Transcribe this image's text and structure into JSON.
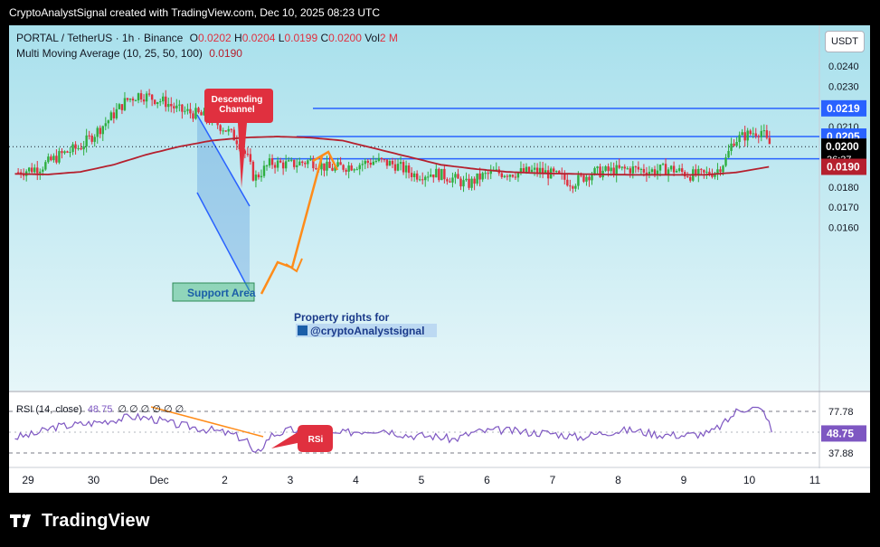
{
  "header": {
    "caption": "CryptoAnalystSignal created with TradingView.com, Dec 10, 2025 08:23 UTC"
  },
  "legend": {
    "symbol": "PORTAL / TetherUS · 1h · Binance",
    "o_label": "O",
    "o_value": "0.0202",
    "h_label": "H",
    "h_value": "0.0204",
    "l_label": "L",
    "l_value": "0.0199",
    "c_label": "C",
    "c_value": "0.0200",
    "vol_label": "Vol",
    "vol_value": "2 M",
    "ma_label": "Multi Moving Average (10, 25, 50, 100)",
    "ma_value": "0.0190"
  },
  "currency_badge": "USDT",
  "annotations": {
    "descending_channel": [
      "Descending",
      "Channel"
    ],
    "support_area": "Support Area",
    "watermark_line1": "Property rights for",
    "watermark_line2": "@cryptoAnalystsignal",
    "rsi_callout": "RSi"
  },
  "rsi_legend": {
    "label": "RSI (14, close)",
    "value": "48.75",
    "extra": "∅ ∅ ∅ ∅ ∅ ∅"
  },
  "brand": {
    "name": "TradingView"
  },
  "colors": {
    "background_top": "#a8e0ec",
    "background_bottom": "#e6f6f9",
    "candle_up": "#2eae3f",
    "candle_down": "#e0303f",
    "ma_line": "#b5202e",
    "level_line": "#2962ff",
    "arrow": "#ff8c1a",
    "rsi_line": "#7e57c2",
    "channel_fill": "#4a90d9"
  },
  "chart_data": [
    {
      "type": "candlestick",
      "title": "PORTAL / TetherUS · 1h · Binance",
      "x_tick_labels": [
        "29",
        "30",
        "Dec",
        "2",
        "3",
        "4",
        "5",
        "6",
        "7",
        "8",
        "9",
        "10",
        "11"
      ],
      "y_tick_labels": [
        "0.0240",
        "0.0230",
        "0.0220",
        "0.0210",
        "0.0200",
        "0.0190",
        "0.0180",
        "0.0170",
        "0.0160"
      ],
      "ylim": [
        0.016,
        0.0246
      ],
      "price_path_points": [
        [
          28.8,
          0.0187
        ],
        [
          29.2,
          0.019
        ],
        [
          29.5,
          0.0196
        ],
        [
          29.8,
          0.02
        ],
        [
          30.0,
          0.0206
        ],
        [
          30.25,
          0.0214
        ],
        [
          30.5,
          0.0223
        ],
        [
          30.7,
          0.0226
        ],
        [
          30.9,
          0.0224
        ],
        [
          31.1,
          0.0222
        ],
        [
          31.3,
          0.0218
        ],
        [
          31.6,
          0.0216
        ],
        [
          31.8,
          0.0213
        ],
        [
          32.0,
          0.0209
        ],
        [
          32.2,
          0.0203
        ],
        [
          32.35,
          0.0194
        ],
        [
          32.45,
          0.0184
        ],
        [
          32.7,
          0.0192
        ],
        [
          33.0,
          0.0191
        ],
        [
          33.3,
          0.0193
        ],
        [
          33.6,
          0.0189
        ],
        [
          34.0,
          0.0191
        ],
        [
          34.3,
          0.0193
        ],
        [
          34.6,
          0.0191
        ],
        [
          34.9,
          0.0186
        ],
        [
          35.2,
          0.0187
        ],
        [
          35.5,
          0.0184
        ],
        [
          35.7,
          0.0181
        ],
        [
          35.9,
          0.0185
        ],
        [
          36.1,
          0.0187
        ],
        [
          36.4,
          0.0187
        ],
        [
          36.8,
          0.0188
        ],
        [
          37.1,
          0.0185
        ],
        [
          37.3,
          0.0182
        ],
        [
          37.6,
          0.0187
        ],
        [
          37.9,
          0.0188
        ],
        [
          38.2,
          0.0189
        ],
        [
          38.5,
          0.0188
        ],
        [
          38.8,
          0.0189
        ],
        [
          39.1,
          0.0186
        ],
        [
          39.3,
          0.0186
        ],
        [
          39.5,
          0.0188
        ],
        [
          39.65,
          0.0194
        ],
        [
          39.75,
          0.0203
        ],
        [
          39.9,
          0.0205
        ],
        [
          40.05,
          0.0207
        ],
        [
          40.2,
          0.0208
        ],
        [
          40.25,
          0.0203
        ],
        [
          40.35,
          0.02
        ]
      ],
      "levels": [
        {
          "label": "0.0219",
          "value": 0.0219
        },
        {
          "label": "0.0205",
          "value": 0.0205
        },
        {
          "label": "0.0194",
          "value": 0.0194
        }
      ],
      "current_price": {
        "label": "0.0200",
        "countdown": "36:37",
        "value": 0.02
      },
      "ma": {
        "label": "0.0190",
        "value": 0.019,
        "points": [
          [
            28.8,
            0.01865
          ],
          [
            29.3,
            0.01862
          ],
          [
            29.8,
            0.01875
          ],
          [
            30.3,
            0.0191
          ],
          [
            30.8,
            0.0196
          ],
          [
            31.3,
            0.02
          ],
          [
            31.8,
            0.0203
          ],
          [
            32.3,
            0.02045
          ],
          [
            32.8,
            0.0205
          ],
          [
            33.3,
            0.02045
          ],
          [
            33.8,
            0.0203
          ],
          [
            34.3,
            0.0199
          ],
          [
            34.8,
            0.0195
          ],
          [
            35.3,
            0.0191
          ],
          [
            35.8,
            0.0189
          ],
          [
            36.3,
            0.01875
          ],
          [
            36.8,
            0.01868
          ],
          [
            37.3,
            0.01865
          ],
          [
            37.8,
            0.01862
          ],
          [
            38.3,
            0.0186
          ],
          [
            38.8,
            0.0186
          ],
          [
            39.3,
            0.0186
          ],
          [
            39.8,
            0.01872
          ],
          [
            40.3,
            0.019
          ]
        ]
      }
    },
    {
      "type": "line",
      "title": "RSI (14, close)",
      "y_tick_labels": [
        "77.78",
        "37.88"
      ],
      "band": [
        30,
        70
      ],
      "current": {
        "label": "48.75",
        "value": 48.75
      },
      "points": [
        [
          28.8,
          45
        ],
        [
          29.1,
          48
        ],
        [
          29.4,
          55
        ],
        [
          29.7,
          57
        ],
        [
          30.0,
          59
        ],
        [
          30.3,
          62
        ],
        [
          30.6,
          65
        ],
        [
          30.9,
          63
        ],
        [
          31.2,
          58
        ],
        [
          31.5,
          55
        ],
        [
          31.8,
          52
        ],
        [
          32.1,
          48
        ],
        [
          32.35,
          42
        ],
        [
          32.45,
          26
        ],
        [
          32.7,
          47
        ],
        [
          33.0,
          52
        ],
        [
          33.3,
          51
        ],
        [
          33.6,
          47
        ],
        [
          34.0,
          51
        ],
        [
          34.4,
          53
        ],
        [
          34.8,
          47
        ],
        [
          35.2,
          46
        ],
        [
          35.5,
          43
        ],
        [
          35.8,
          50
        ],
        [
          36.2,
          52
        ],
        [
          36.6,
          50
        ],
        [
          37.0,
          49
        ],
        [
          37.4,
          45
        ],
        [
          37.8,
          50
        ],
        [
          38.2,
          52
        ],
        [
          38.6,
          48
        ],
        [
          39.0,
          47
        ],
        [
          39.4,
          49
        ],
        [
          39.65,
          60
        ],
        [
          39.8,
          70
        ],
        [
          40.0,
          74
        ],
        [
          40.15,
          72
        ],
        [
          40.25,
          68
        ],
        [
          40.35,
          48.75
        ]
      ]
    }
  ]
}
